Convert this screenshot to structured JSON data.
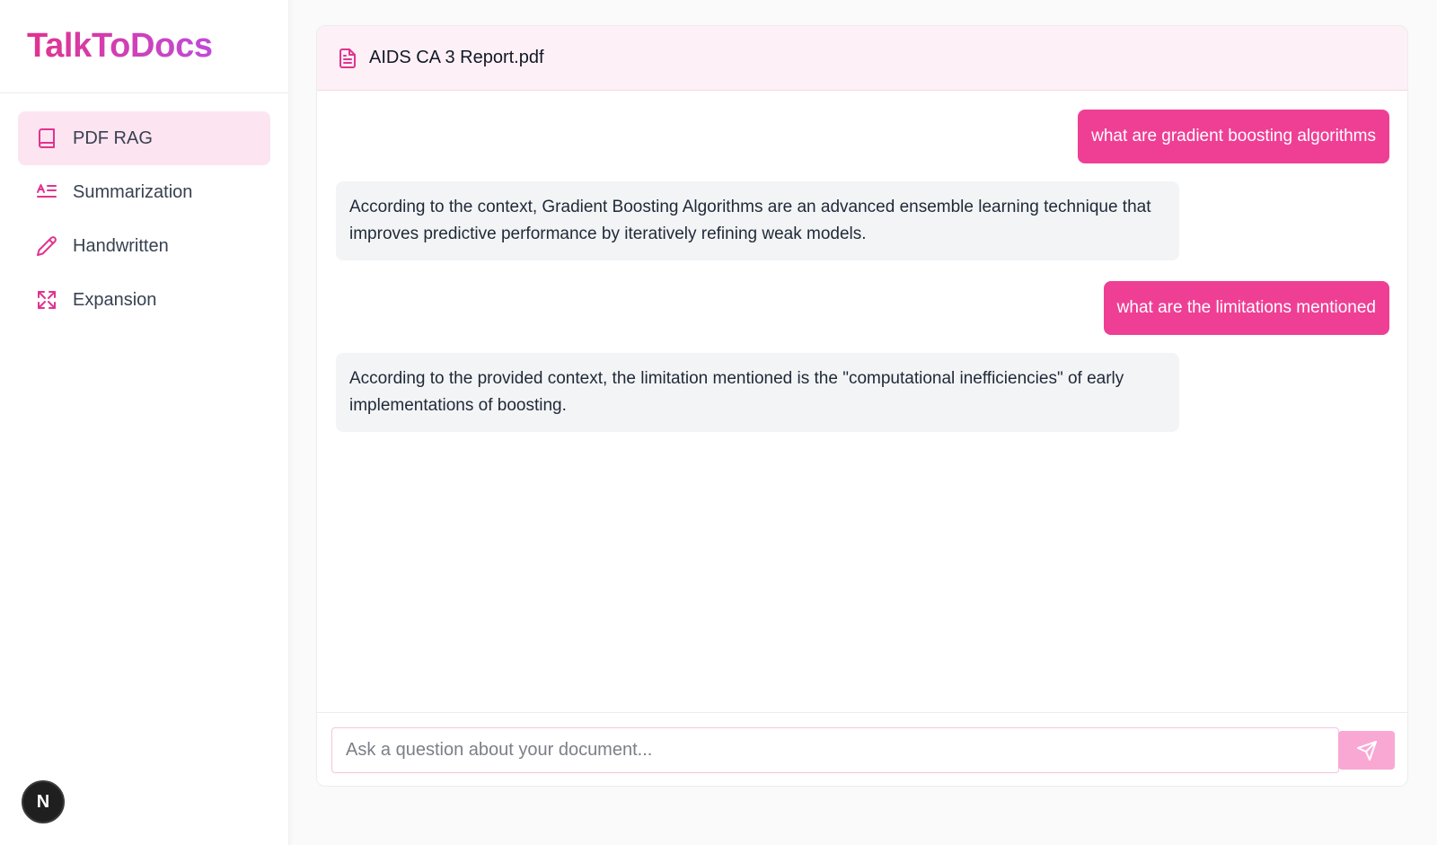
{
  "brand": {
    "title": "TalkToDocs"
  },
  "sidebar": {
    "items": [
      {
        "label": "PDF RAG",
        "icon": "book-icon",
        "active": true
      },
      {
        "label": "Summarization",
        "icon": "text-summary-icon",
        "active": false
      },
      {
        "label": "Handwritten",
        "icon": "pencil-icon",
        "active": false
      },
      {
        "label": "Expansion",
        "icon": "expand-icon",
        "active": false
      }
    ]
  },
  "avatar": {
    "initial": "N"
  },
  "document": {
    "file_name": "AIDS CA 3 Report.pdf",
    "icon": "file-text-icon"
  },
  "chat": {
    "messages": [
      {
        "role": "user",
        "text": "what are gradient boosting algorithms"
      },
      {
        "role": "assistant",
        "text": "According to the context, Gradient Boosting Algorithms are an advanced ensemble learning technique that improves predictive performance by iteratively refining weak models."
      },
      {
        "role": "user",
        "text": "what are the limitations mentioned"
      },
      {
        "role": "assistant",
        "text": "According to the provided context, the limitation mentioned is the \"computational inefficiencies\" of early implementations of boosting."
      }
    ]
  },
  "composer": {
    "placeholder": "Ask a question about your document...",
    "value": "",
    "send_icon": "send-icon"
  },
  "colors": {
    "accent": "#ef3f95",
    "accent_light": "#fce4f1",
    "send_button": "#f9a8d4",
    "bubble_bot": "#f3f4f6"
  }
}
